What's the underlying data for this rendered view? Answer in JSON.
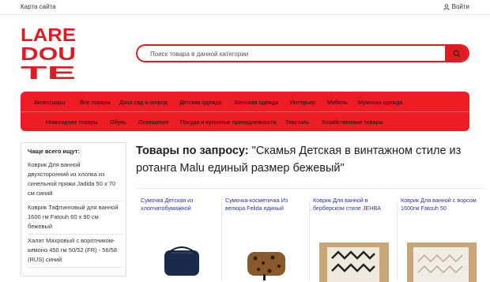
{
  "topbar": {
    "sitemap": "Карта сайта",
    "login": "Войти"
  },
  "logo": {
    "line1": "LARE",
    "line2": "DOU",
    "line3": "TE"
  },
  "search": {
    "placeholder": "Поиск товара в данной категории"
  },
  "menu": {
    "row1": [
      "Аксессуары",
      "Все товары",
      "Дача сад и огород",
      "Детская одежда",
      "Женская одежда",
      "Интерьер",
      "Мебель",
      "Мужская одежда"
    ],
    "row2": [
      "Новогодние товары",
      "Обувь",
      "Освещение",
      "Посуда и кухонные принадлежности",
      "Текстиль",
      "Хозяйственные товары"
    ]
  },
  "sidebar": {
    "title": "Чаще всего ищут:",
    "items": [
      "Коврик Для ванной двухсторонний из хлопка из синельной пряжи Jadida 50 х 70 см синий",
      "Коврик Тафтинговый для ванной 1600 гм Fatouh 60 х 90 см бежевый",
      "Халат Махровый с воротником-кимоно 450 гм 50/52 (FR) - 56/58 (RUS) синий"
    ]
  },
  "page": {
    "title_prefix": "Товары по запросу:",
    "title_query": "\"Скамья Детская в винтажном стиле из ротанга Malu единый размер бежевый\""
  },
  "products": [
    {
      "title": "Сумочка Детская из хлопчатобумажной"
    },
    {
      "title": "Сумочка-косметичка Из велюра Felida единый"
    },
    {
      "title": "Коврик Для ванной в берберском стиле JEHBA"
    },
    {
      "title": "Коврик Для ванной с ворсом 1600гм Fatouh 50"
    }
  ],
  "colors": {
    "accent": "#ee1c25",
    "link": "#2f2fb2"
  }
}
